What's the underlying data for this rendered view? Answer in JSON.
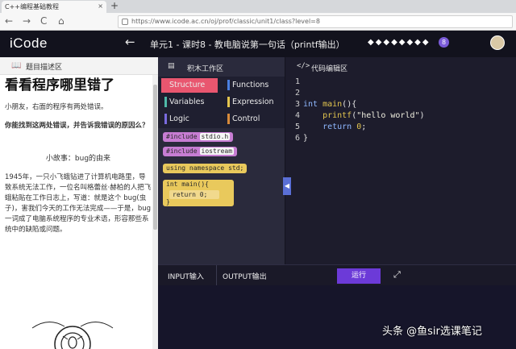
{
  "browser": {
    "tab_title": "C++编程基础教程",
    "tab_close": "×",
    "new_tab": "+",
    "back": "←",
    "forward": "→",
    "reload": "C",
    "home": "⌂",
    "url": "https://www.icode.ac.cn/oj/prof/classic/unit1/class?level=8"
  },
  "header": {
    "logo": "iCode",
    "back_arrow": "←",
    "title": "单元1 - 课时8 - 教电脑说第一句话（printf输出）",
    "progress_dots": "◆◆◆◆◆◆◆◆",
    "current_level": "8"
  },
  "left_panel": {
    "title": "题目描述区",
    "heading": "看看程序哪里错了",
    "intro": "小朋友，右面的程序有两处错误。",
    "task": "你能找到这两处错误，并告诉我错误的原因么？",
    "story_title": "小故事：bug的由来",
    "story_text": "1945年，一只小飞蛾钻进了计算机电路里，导致系统无法工作，一位名叫格蕾丝·赫柏的人把飞蛾粘贴在工作日志上，写道：就是这个 bug(虫子)，害我们今天的工作无法完成——于是，bug一词成了电脑系统程序的专业术语，形容那些系统中的缺陷或问题。"
  },
  "blocks_panel": {
    "title": "积木工作区",
    "categories": [
      "Structure",
      "Functions",
      "Variables",
      "Expression",
      "Logic",
      "Control"
    ],
    "colors": {
      "structure": "#e9566f",
      "functions": "#4a7fe0",
      "variables": "#4fb9a8",
      "expression": "#e4c64f",
      "logic": "#7a6be0",
      "control": "#d88a3a"
    },
    "blocks": {
      "include1": "#include",
      "include1_arg": "stdio.h",
      "include2": "#include",
      "include2_arg": "iostream",
      "using": "using namespace std;",
      "main": "int main(){",
      "return": "return 0;",
      "close": "}"
    }
  },
  "editor": {
    "title": "代码编辑区",
    "icon": "</>",
    "lines": [
      {
        "n": "1",
        "text": ""
      },
      {
        "n": "2",
        "text": ""
      },
      {
        "n": "3",
        "kw": "int",
        "fn": " main",
        "pl": "(){"
      },
      {
        "n": "4",
        "fn": "    printf",
        "pl": "(",
        "str": "\"hello world\"",
        "pl2": ")"
      },
      {
        "n": "5",
        "kw": "    return",
        "num": " 0",
        "pl": ";"
      },
      {
        "n": "6",
        "pl": "}"
      }
    ]
  },
  "console": {
    "input_tab": "INPUT输入",
    "output_tab": "OUTPUT输出",
    "run_button": "运行",
    "expand_icon": "⤢"
  },
  "watermark": "头条 @鱼sir选课笔记"
}
